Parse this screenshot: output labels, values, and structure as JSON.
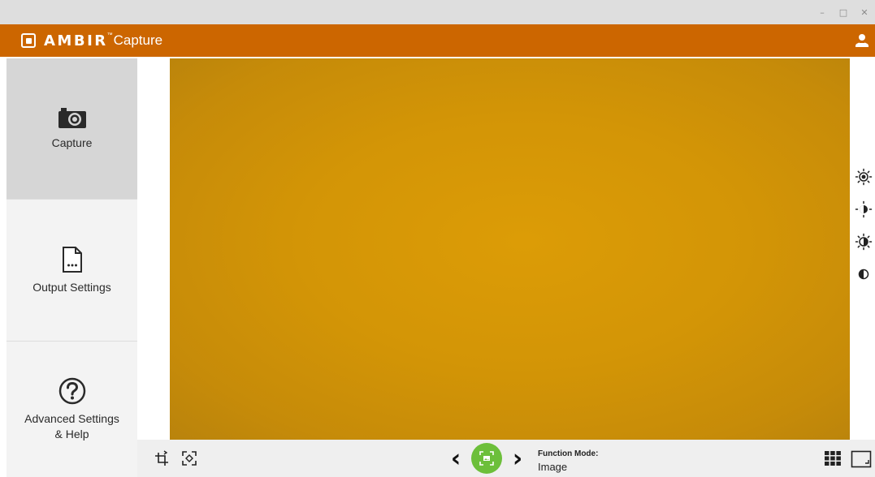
{
  "window": {
    "controls": {
      "minimize": "–",
      "maximize": "□",
      "close": "✕"
    }
  },
  "brand": {
    "name": "AMBIR",
    "tm": "™",
    "product": "Capture",
    "color": "#cc6600"
  },
  "sidebar": {
    "items": [
      {
        "label": "Capture",
        "icon": "camera-icon",
        "active": true
      },
      {
        "label": "Output Settings",
        "icon": "document-icon",
        "active": false
      },
      {
        "label_line1": "Advanced Settings",
        "label_line2": "& Help",
        "icon": "help-icon",
        "active": false
      }
    ]
  },
  "right_tools": [
    {
      "icon": "auto-brightness-icon"
    },
    {
      "icon": "brightness-icon"
    },
    {
      "icon": "exposure-icon"
    },
    {
      "icon": "contrast-icon"
    }
  ],
  "bottombar": {
    "left_tools": [
      {
        "icon": "crop-rotate-icon"
      },
      {
        "icon": "auto-crop-icon"
      }
    ],
    "prev": "‹",
    "next": "›",
    "function_mode_label": "Function Mode:",
    "function_mode_value": "Image",
    "right_tools": [
      {
        "icon": "grid-view-icon"
      },
      {
        "icon": "fullscreen-icon"
      }
    ],
    "shutter_color": "#6cbf3a"
  }
}
